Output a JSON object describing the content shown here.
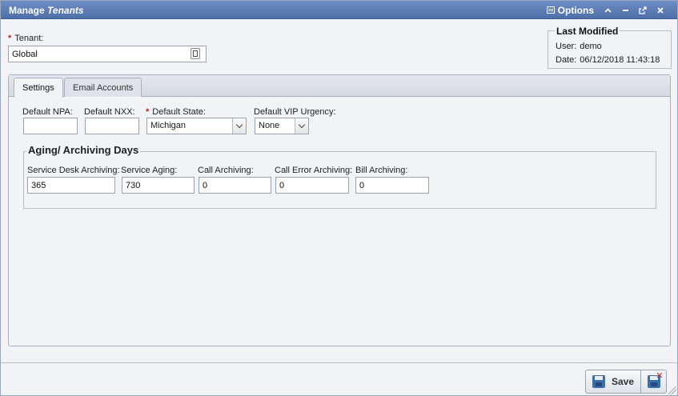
{
  "window": {
    "title_prefix": "Manage",
    "title_emphasis": "Tenants",
    "options_label": "Options",
    "tool_icons": [
      "collapse-icon",
      "minimize-icon",
      "popout-icon",
      "close-icon"
    ]
  },
  "tenant": {
    "label": "Tenant:",
    "required_mark": "*",
    "value": "Global"
  },
  "last_modified": {
    "title": "Last Modified",
    "user_label": "User:",
    "user_value": "demo",
    "date_label": "Date:",
    "date_value": "06/12/2018 11:43:18"
  },
  "tabs": [
    {
      "label": "Settings",
      "active": true
    },
    {
      "label": "Email Accounts",
      "active": false
    }
  ],
  "settings": {
    "npa": {
      "label": "Default NPA:",
      "value": ""
    },
    "nxx": {
      "label": "Default NXX:",
      "value": ""
    },
    "state": {
      "label": "Default State:",
      "required_mark": "*",
      "value": "Michigan"
    },
    "vip": {
      "label": "Default VIP Urgency:",
      "value": "None"
    }
  },
  "aging": {
    "title": "Aging/ Archiving Days",
    "fields": [
      {
        "label": "Service Desk Archiving:",
        "value": "365"
      },
      {
        "label": "Service Aging:",
        "value": "730"
      },
      {
        "label": "Call Archiving:",
        "value": "0"
      },
      {
        "label": "Call Error Archiving:",
        "value": "0"
      },
      {
        "label": "Bill Archiving:",
        "value": "0"
      }
    ]
  },
  "footer": {
    "save_label": "Save"
  },
  "colors": {
    "titlebar": "#5577b0",
    "required": "#c62020",
    "accent": "#3a6ea8"
  }
}
